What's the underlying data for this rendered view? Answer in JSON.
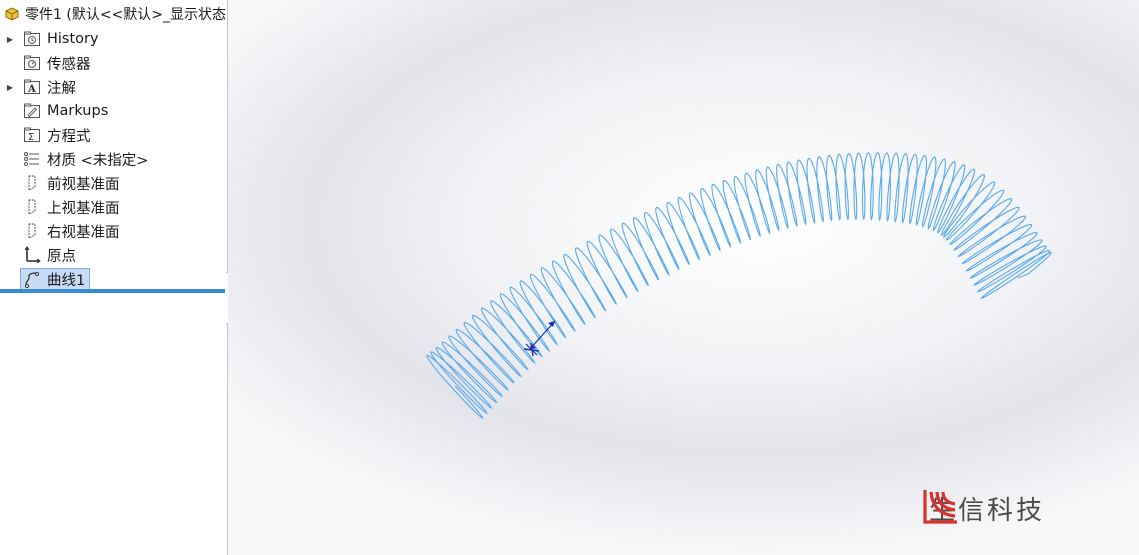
{
  "tree": {
    "root_label": "零件1 (默认<<默认>_显示状态",
    "items": [
      {
        "label": "History",
        "icon": "history-folder-icon",
        "expandable": true
      },
      {
        "label": "传感器",
        "icon": "sensor-icon",
        "expandable": false
      },
      {
        "label": "注解",
        "icon": "annotation-icon",
        "expandable": true
      },
      {
        "label": "Markups",
        "icon": "markups-icon",
        "expandable": false
      },
      {
        "label": "方程式",
        "icon": "equation-icon",
        "expandable": false
      },
      {
        "label": "材质 <未指定>",
        "icon": "material-icon",
        "expandable": false
      },
      {
        "label": "前视基准面",
        "icon": "plane-icon",
        "expandable": false
      },
      {
        "label": "上视基准面",
        "icon": "plane-icon",
        "expandable": false
      },
      {
        "label": "右视基准面",
        "icon": "plane-icon",
        "expandable": false
      },
      {
        "label": "原点",
        "icon": "origin-icon",
        "expandable": false
      },
      {
        "label": "曲线1",
        "icon": "curve-icon",
        "expandable": false,
        "selected": true
      }
    ]
  },
  "viewport": {
    "curve_color": "#5aa9ec",
    "triad_color": "#1b2fa8"
  },
  "watermark": {
    "text": "生信科技",
    "logo_color": "#d9312b"
  }
}
